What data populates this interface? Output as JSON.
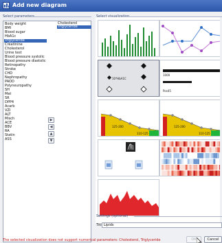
{
  "window": {
    "title": "Add new diagram"
  },
  "params": {
    "label": "Select parameters",
    "items": [
      "Body weight",
      "BMI",
      "Blood sugar",
      "HbA1c",
      "Triglyceride",
      "Creatinine",
      "Cholesterol",
      "Urine test",
      "Blood pressure systolic",
      "Blood pressure diastolic",
      "Retinopathy",
      "Stroke",
      "CHD",
      "Nephropathy",
      "PAOD",
      "Polyneuropathy",
      "SH",
      "Met",
      "SR",
      "DPP4",
      "Acarb",
      "VZI",
      "ALT",
      "Misch",
      "ACE",
      "BBV",
      "RA",
      "Statin",
      "ASS"
    ],
    "selected_index": 4,
    "selected_items": [
      "Cholesterol",
      "Triglyceride"
    ],
    "selected_highlight_index": 1
  },
  "viz": {
    "label": "Select visualization",
    "thumbs": [
      {
        "id": "bars",
        "selected": false
      },
      {
        "id": "lines",
        "selected": false
      },
      {
        "id": "points",
        "selected": true,
        "caption": "10*HbA1C"
      },
      {
        "id": "range",
        "selected": false,
        "cap1": "1000",
        "cap2": "Pos45"
      },
      {
        "id": "area-ranges",
        "selected": false,
        "cap1": "125-200",
        "cap2": "110-125"
      },
      {
        "id": "area-ranges-2",
        "selected": false,
        "cap1": "125-200",
        "cap2": "110-125"
      },
      {
        "id": "images",
        "selected": false
      },
      {
        "id": "heatmap",
        "selected": false
      },
      {
        "id": "area",
        "selected": false
      }
    ]
  },
  "settings": {
    "label": "Settings (optional)",
    "title_label": "Title",
    "title_value": "Lipids"
  },
  "status": "The selected visualization does not support numerical parameters: Cholesterol, Triglyceride",
  "buttons": {
    "ok": "OK",
    "cancel": "Cancel"
  }
}
